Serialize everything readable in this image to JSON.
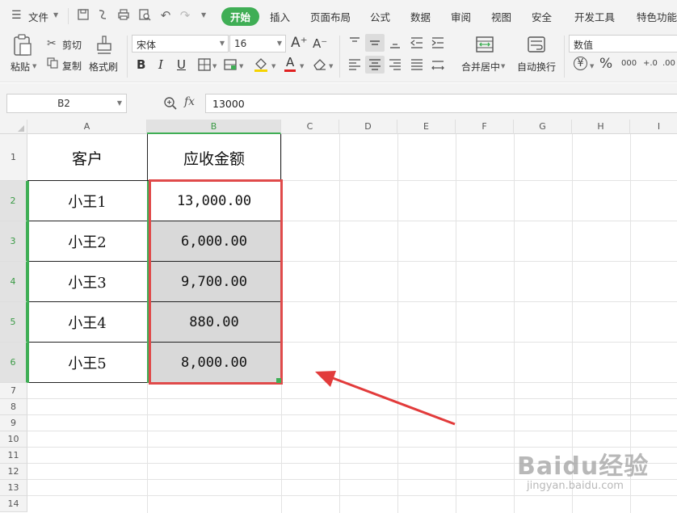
{
  "menubar": {
    "file_label": "文件",
    "tabs": [
      "开始",
      "插入",
      "页面布局",
      "公式",
      "数据",
      "审阅",
      "视图",
      "安全",
      "开发工具",
      "特色功能"
    ],
    "active_tab": "开始"
  },
  "ribbon": {
    "paste_label": "粘贴",
    "cut_label": "剪切",
    "copy_label": "复制",
    "format_painter_label": "格式刷",
    "font_name": "宋体",
    "font_size": "16",
    "bold_label": "B",
    "italic_label": "I",
    "underline_label": "U",
    "font_color_label": "A",
    "grow_font_label": "A⁺",
    "shrink_font_label": "A⁻",
    "merge_center_label": "合并居中",
    "wrap_text_label": "自动换行",
    "number_format": "数值",
    "percent_label": "%",
    "comma_label": "000",
    "currency_label": "¥",
    "inc_decimal_label": "+.0",
    "dec_decimal_label": ".00"
  },
  "formula_bar": {
    "name_box": "B2",
    "fx_label": "fx",
    "value": "13000"
  },
  "sheet": {
    "columns": [
      "A",
      "B",
      "C",
      "D",
      "E",
      "F",
      "G",
      "H",
      "I"
    ],
    "rows": [
      "1",
      "2",
      "3",
      "4",
      "5",
      "6",
      "7",
      "8",
      "9",
      "10",
      "11",
      "12",
      "13",
      "14"
    ],
    "selected_column": "B",
    "header_row": {
      "a": "客户",
      "b": "应收金额"
    },
    "data_rows": [
      {
        "a": "小王1",
        "b": "13,000.00"
      },
      {
        "a": "小王2",
        "b": "6,000.00"
      },
      {
        "a": "小王3",
        "b": "9,700.00"
      },
      {
        "a": "小王4",
        "b": "880.00"
      },
      {
        "a": "小王5",
        "b": "8,000.00"
      }
    ]
  },
  "colors": {
    "accent_green": "#3fae55",
    "selection_red": "#e04a4a",
    "cell_shade": "#d9d9d9"
  },
  "watermark": {
    "brand": "Baidu经验",
    "url": "jingyan.baidu.com"
  }
}
